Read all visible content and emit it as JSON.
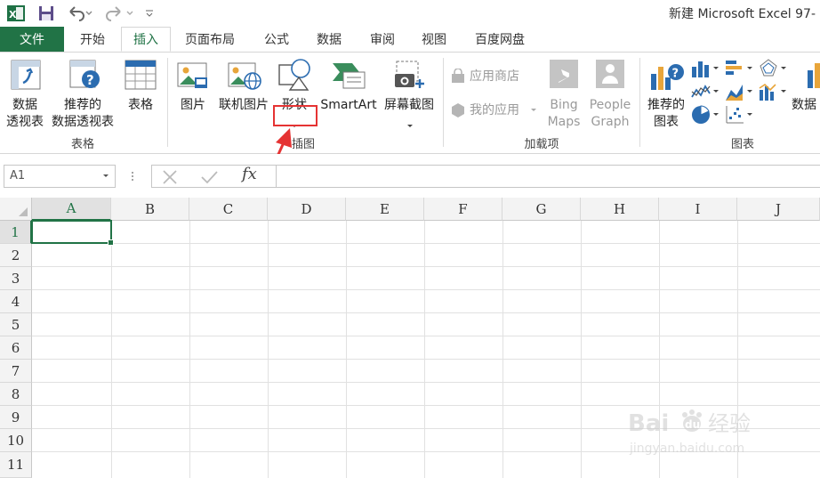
{
  "app": {
    "title": "新建 Microsoft Excel 97-"
  },
  "tabs": [
    {
      "label": "文件",
      "key": "file"
    },
    {
      "label": "开始",
      "key": "home"
    },
    {
      "label": "插入",
      "key": "insert",
      "active": true
    },
    {
      "label": "页面布局",
      "key": "page-layout"
    },
    {
      "label": "公式",
      "key": "formulas"
    },
    {
      "label": "数据",
      "key": "data"
    },
    {
      "label": "审阅",
      "key": "review"
    },
    {
      "label": "视图",
      "key": "view"
    },
    {
      "label": "百度网盘",
      "key": "baidu-netdisk"
    }
  ],
  "ribbon": {
    "tables": {
      "pivot_line1": "数据",
      "pivot_line2": "透视表",
      "rec_pivot_line1": "推荐的",
      "rec_pivot_line2": "数据透视表",
      "table": "表格",
      "group": "表格"
    },
    "illustrations": {
      "picture": "图片",
      "online_picture": "联机图片",
      "shapes": "形状",
      "smartart": "SmartArt",
      "screenshot": "屏幕截图",
      "group": "插图"
    },
    "addins": {
      "store": "应用商店",
      "my_apps": "我的应用",
      "bing_line1": "Bing",
      "bing_line2": "Maps",
      "people_line1": "People",
      "people_line2": "Graph",
      "group": "加载项"
    },
    "charts": {
      "rec_line1": "推荐的",
      "rec_line2": "图表",
      "pivot_chart_cut": "数据",
      "group": "图表"
    }
  },
  "formula_bar": {
    "name_box": "A1",
    "fx": "fx",
    "content": ""
  },
  "grid": {
    "columns": [
      "A",
      "B",
      "C",
      "D",
      "E",
      "F",
      "G",
      "H",
      "I",
      "J"
    ],
    "rows": [
      "1",
      "2",
      "3",
      "4",
      "5",
      "6",
      "7",
      "8",
      "9",
      "10",
      "11"
    ],
    "selected_cell": "A1"
  },
  "colors": {
    "excel_green": "#217346",
    "annotation_red": "#e53333"
  },
  "watermark": {
    "brand": "Bai du 经验",
    "url": "jingyan.baidu.com"
  }
}
